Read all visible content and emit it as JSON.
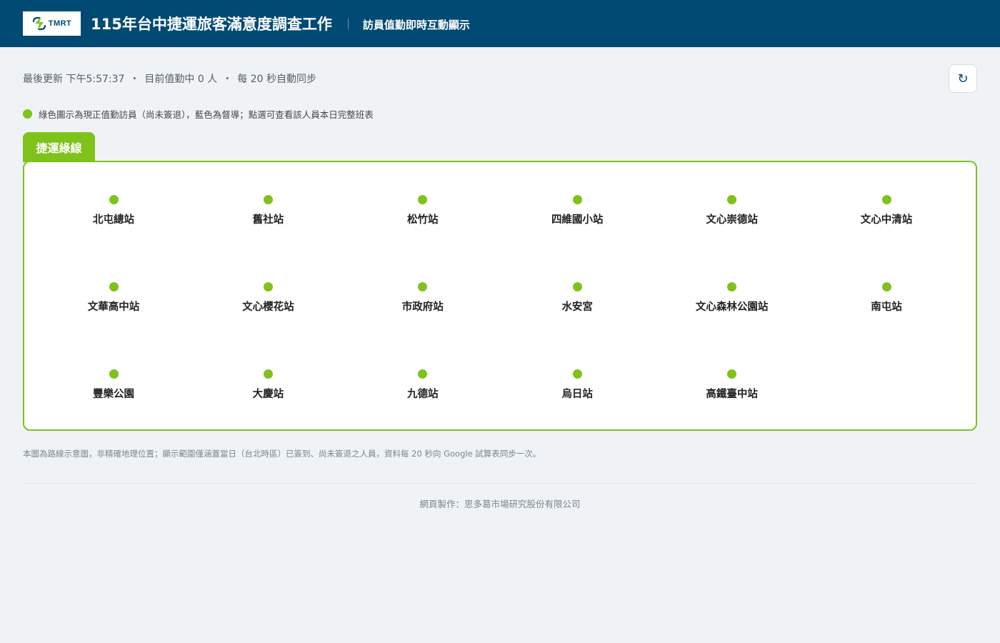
{
  "header": {
    "logo_text": "TMRT",
    "title": "115年台中捷運旅客滿意度調查工作",
    "subtitle": "訪員值勤即時互動顯示"
  },
  "status": {
    "last_updated": "最後更新 下午5:57:37",
    "on_duty": "目前值勤中 0 人",
    "sync": "每 20 秒自動同步",
    "separator": "・"
  },
  "refresh_button": {
    "icon": "refresh-icon",
    "glyph": "↻"
  },
  "legend": {
    "text": "綠色圖示為現正值勤訪員（尚未簽退），藍色為督導；點選可查看該人員本日完整班表",
    "color": "#7fc21b"
  },
  "line": {
    "name": "捷運綠線",
    "color": "#7fc21b",
    "stations": [
      "北屯總站",
      "舊社站",
      "松竹站",
      "四維國小站",
      "文心崇德站",
      "文心中清站",
      "文華高中站",
      "文心櫻花站",
      "市政府站",
      "水安宮",
      "文心森林公園站",
      "南屯站",
      "豐樂公園",
      "大慶站",
      "九德站",
      "烏日站",
      "高鐵臺中站"
    ]
  },
  "footnote": "本圖為路線示意圖，非精確地理位置；顯示範圍僅涵蓋當日（台北時區）已簽到、尚未簽退之人員，資料每 20 秒向 Google 試算表同步一次。",
  "credit": "網頁製作：思多葛市場研究股份有限公司",
  "colors": {
    "header_bg": "#004a74",
    "page_bg": "#eff3f6",
    "accent_green": "#7fc21b"
  }
}
